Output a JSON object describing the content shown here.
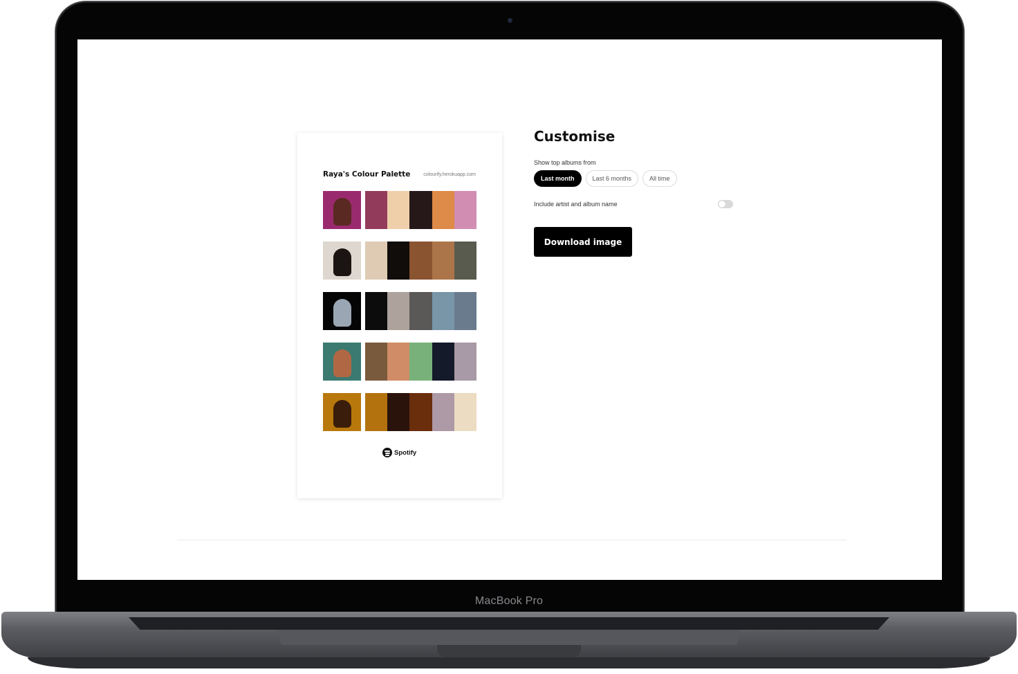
{
  "device": {
    "brand": "MacBook Pro"
  },
  "card": {
    "title": "Raya's Colour Palette",
    "url": "colourify.herokuapp.com",
    "footer": "Spotify",
    "rows": [
      {
        "cover_bg": "#9a2a6e",
        "cover_fig": "#5a2a22",
        "swatches": [
          "#933b5a",
          "#efcfa9",
          "#261819",
          "#de8a48",
          "#d28db3"
        ]
      },
      {
        "cover_bg": "#ded7cf",
        "cover_fig": "#1a1512",
        "swatches": [
          "#dfcbb3",
          "#110d0a",
          "#8a5430",
          "#ac7549",
          "#585b4d"
        ]
      },
      {
        "cover_bg": "#050505",
        "cover_fig": "#9aa6b3",
        "swatches": [
          "#0c0c0c",
          "#ada29c",
          "#5b5858",
          "#7896a8",
          "#6a7b8e"
        ]
      },
      {
        "cover_bg": "#3a7a70",
        "cover_fig": "#b06844",
        "swatches": [
          "#7a5a3c",
          "#d08c66",
          "#78b27a",
          "#141a2a",
          "#a89aa6"
        ]
      },
      {
        "cover_bg": "#b8780c",
        "cover_fig": "#3a1d0a",
        "swatches": [
          "#b3720d",
          "#2a130b",
          "#6a2e0d",
          "#ad9aa6",
          "#ecdcc2"
        ]
      }
    ]
  },
  "customise": {
    "title": "Customise",
    "range_label": "Show top albums from",
    "ranges": [
      "Last month",
      "Last 6 months",
      "All time"
    ],
    "selected_range": "Last month",
    "toggle_label": "Include artist and album name",
    "toggle_on": false,
    "download_label": "Download image"
  }
}
